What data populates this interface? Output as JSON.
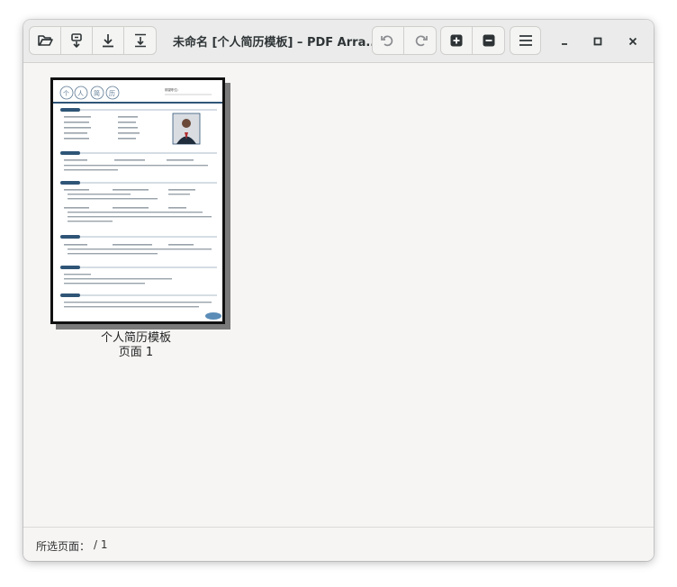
{
  "window": {
    "title": "未命名 [个人简历模板] – PDF Arra...",
    "controls": [
      "minimize-icon",
      "maximize-icon",
      "close-icon"
    ]
  },
  "toolbar": {
    "left_buttons": [
      "folder-open-icon",
      "import-icon",
      "download-icon",
      "export-icon"
    ],
    "undo_icon": "undo-icon",
    "redo_icon": "redo-icon",
    "zoom_in_icon": "zoom-in-icon",
    "zoom_out_icon": "zoom-out-icon",
    "menu_icon": "hamburger-menu-icon"
  },
  "page": {
    "name": "个人简历模板",
    "label": "页面 1",
    "thumbnail_header_chars": [
      "个",
      "人",
      "简",
      "历"
    ],
    "thumbnail_header_subtitle": "期望职位："
  },
  "status": {
    "label": "所选页面：",
    "value": "/ 1"
  },
  "colors": {
    "accent": "#2f5577",
    "headerbar": "#ebebeb",
    "background": "#f6f5f4"
  }
}
